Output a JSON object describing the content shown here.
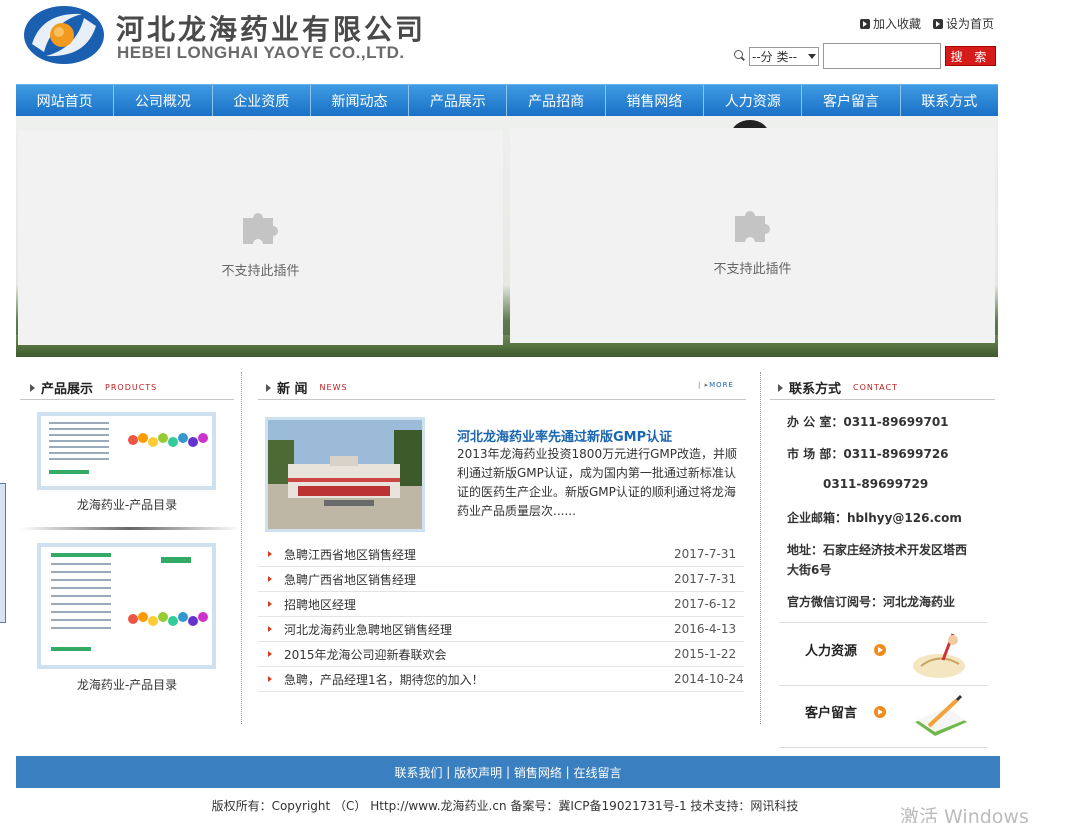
{
  "header": {
    "company_cn": "河北龙海药业有限公司",
    "company_en": "HEBEI LONGHAI YAOYE CO.,LTD.",
    "links": [
      "加入收藏",
      "设为首页"
    ],
    "search": {
      "category": "--分 类--",
      "button": "搜 索"
    }
  },
  "nav": [
    "网站首页",
    "公司概况",
    "企业资质",
    "新闻动态",
    "产品展示",
    "产品招商",
    "销售网络",
    "人力资源",
    "客户留言",
    "联系方式"
  ],
  "banner": {
    "plugin_text_left": "不支持此插件",
    "plugin_text_right": "不支持此插件"
  },
  "products": {
    "title": "产品展示",
    "title_en": "PRODUCTS",
    "items": [
      "龙海药业-产品目录",
      "龙海药业-产品目录"
    ]
  },
  "news": {
    "title": "新 闻",
    "title_en": "NEWS",
    "more": "MORE",
    "headline": "河北龙海药业率先通过新版GMP认证",
    "summary": "2013年龙海药业投资1800万元进行GMP改造，并顺利通过新版GMP认证，成为国内第一批通过新标准认证的医药生产企业。新版GMP认证的顺利通过将龙海药业产品质量层次......",
    "list": [
      {
        "title": "急聘江西省地区销售经理",
        "date": "2017-7-31"
      },
      {
        "title": "急聘广西省地区销售经理",
        "date": "2017-7-31"
      },
      {
        "title": "招聘地区经理",
        "date": "2017-6-12"
      },
      {
        "title": "河北龙海药业急聘地区销售经理",
        "date": "2016-4-13"
      },
      {
        "title": "2015年龙海公司迎新春联欢会",
        "date": "2015-1-22"
      },
      {
        "title": "急聘，产品经理1名，期待您的加入！",
        "date": "2014-10-24"
      }
    ]
  },
  "contact": {
    "title": "联系方式",
    "title_en": "CONTACT",
    "office": "办 公 室：0311-89699701",
    "market": "市 场 部：0311-89699726",
    "market2": "0311-89699729",
    "email": "企业邮箱：hblhyy@126.com",
    "address_1": "地址：石家庄经济技术开发区塔西",
    "address_2": "大街6号",
    "wechat": "官方微信订阅号：河北龙海药业",
    "cards": [
      "人力资源",
      "客户留言"
    ]
  },
  "footer": {
    "links": [
      "联系我们",
      "版权声明",
      "销售网络",
      "在线留言"
    ],
    "copyright": "版权所有：Copyright （C） Http://www.龙海药业.cn  备案号：冀ICP备19021731号-1  技术支持：网讯科技"
  },
  "watermark": "激活 Windows"
}
